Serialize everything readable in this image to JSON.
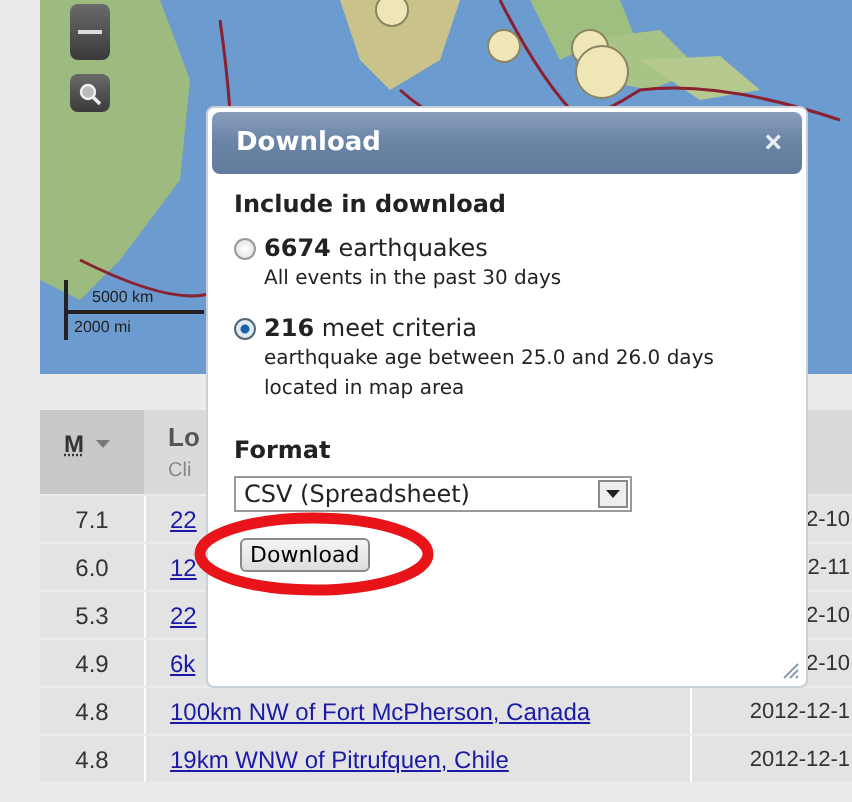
{
  "map": {
    "kind": "picture",
    "scale": [
      "5000 km",
      "2000 mi"
    ]
  },
  "table": {
    "columns": [
      {
        "label": "M",
        "sorted": true
      },
      {
        "label": "Lo",
        "hint": "Cli"
      }
    ],
    "rows": [
      {
        "magnitude": "7.1",
        "location": "22",
        "time": "2-10"
      },
      {
        "magnitude": "6.0",
        "location": "12",
        "time": "2-11"
      },
      {
        "magnitude": "5.3",
        "location": "22",
        "time": "2-10"
      },
      {
        "magnitude": "4.9",
        "location": "6k",
        "time": "2-10"
      },
      {
        "magnitude": "4.8",
        "location": "100km NW of Fort McPherson, Canada",
        "time": "2012-12-1"
      },
      {
        "magnitude": "4.8",
        "location": "19km WNW of Pitrufquen, Chile",
        "time": "2012-12-1"
      }
    ]
  },
  "dialog": {
    "title": "Download",
    "close": "×",
    "section": "Include in download",
    "options": [
      {
        "count": "6674",
        "label": "earthquakes",
        "details": [
          "All events in the past 30 days"
        ],
        "selected": false
      },
      {
        "count": "216",
        "label": "meet criteria",
        "details": [
          "earthquake age between 25.0 and 26.0 days",
          "located in map area"
        ],
        "selected": true
      }
    ],
    "format_label": "Format",
    "format": "CSV (Spreadsheet)",
    "button": "Download"
  }
}
